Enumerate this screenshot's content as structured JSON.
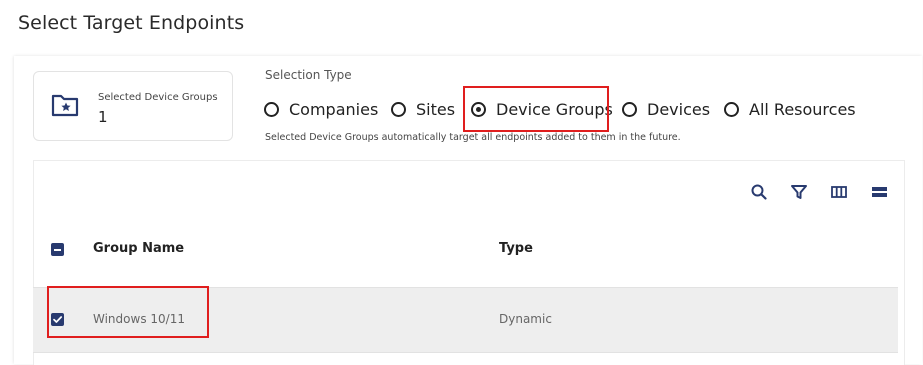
{
  "page": {
    "title": "Select Target Endpoints"
  },
  "summary": {
    "label": "Selected Device Groups",
    "count": "1"
  },
  "selection": {
    "label": "Selection Type",
    "options": [
      {
        "label": "Companies",
        "selected": false
      },
      {
        "label": "Sites",
        "selected": false
      },
      {
        "label": "Device Groups",
        "selected": true
      },
      {
        "label": "Devices",
        "selected": false
      },
      {
        "label": "All Resources",
        "selected": false
      }
    ],
    "hint": "Selected Device Groups automatically target all endpoints added to them in the future."
  },
  "toolbar": {
    "icons": [
      "search-icon",
      "filter-icon",
      "columns-icon",
      "density-icon"
    ]
  },
  "table": {
    "columns": [
      "Group Name",
      "Type"
    ],
    "rows": [
      {
        "name": "Windows 10/11",
        "type": "Dynamic",
        "checked": true
      }
    ]
  },
  "colors": {
    "accent": "#283a6f",
    "highlight": "#e01e1e",
    "row_selected": "#eeeeee"
  }
}
